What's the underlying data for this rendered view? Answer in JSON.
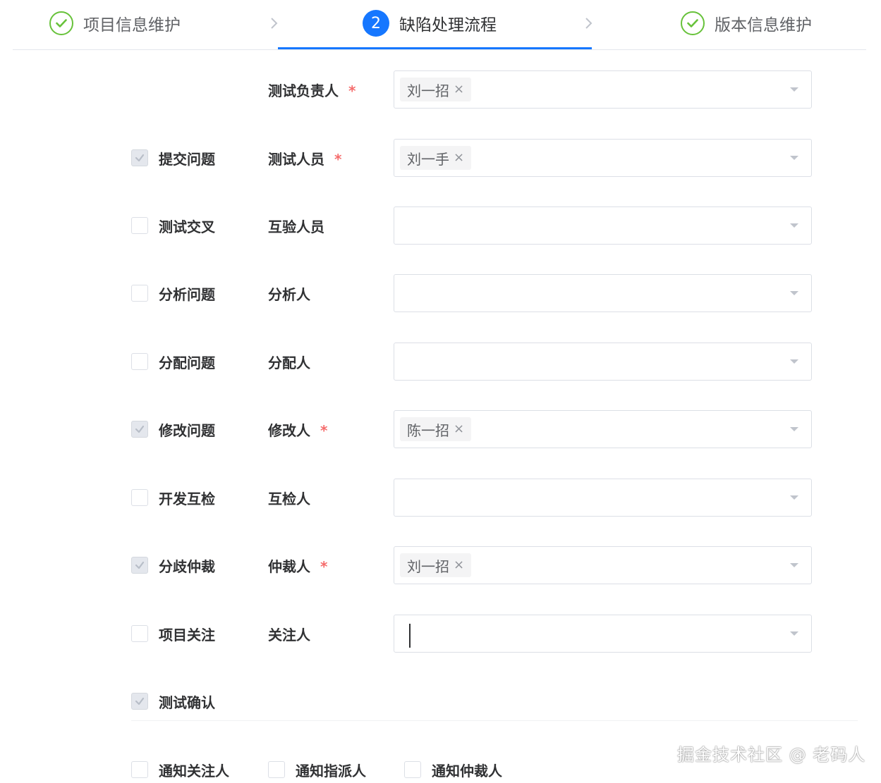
{
  "steps": [
    {
      "label": "项目信息维护",
      "status": "done"
    },
    {
      "label": "缺陷处理流程",
      "status": "active",
      "number": "2"
    },
    {
      "label": "版本信息维护",
      "status": "done"
    }
  ],
  "rows": [
    {
      "checkbox": null,
      "field_label": "测试负责人",
      "required": true,
      "tags": [
        "刘一招"
      ]
    },
    {
      "checkbox": {
        "label": "提交问题",
        "checked": true
      },
      "field_label": "测试人员",
      "required": true,
      "tags": [
        "刘一手"
      ]
    },
    {
      "checkbox": {
        "label": "测试交叉",
        "checked": false
      },
      "field_label": "互验人员",
      "required": false,
      "tags": []
    },
    {
      "checkbox": {
        "label": "分析问题",
        "checked": false
      },
      "field_label": "分析人",
      "required": false,
      "tags": []
    },
    {
      "checkbox": {
        "label": "分配问题",
        "checked": false
      },
      "field_label": "分配人",
      "required": false,
      "tags": []
    },
    {
      "checkbox": {
        "label": "修改问题",
        "checked": true
      },
      "field_label": "修改人",
      "required": true,
      "tags": [
        "陈一招"
      ]
    },
    {
      "checkbox": {
        "label": "开发互检",
        "checked": false
      },
      "field_label": "互检人",
      "required": false,
      "tags": []
    },
    {
      "checkbox": {
        "label": "分歧仲裁",
        "checked": true
      },
      "field_label": "仲裁人",
      "required": true,
      "tags": [
        "刘一招"
      ]
    },
    {
      "checkbox": {
        "label": "项目关注",
        "checked": false
      },
      "field_label": "关注人",
      "required": false,
      "tags": [],
      "focused": true
    },
    {
      "checkbox": {
        "label": "测试确认",
        "checked": true
      },
      "field_label": null
    }
  ],
  "required_mark": "*",
  "tag_close": "×",
  "notify": [
    {
      "label": "通知关注人",
      "checked": false
    },
    {
      "label": "通知指派人",
      "checked": false
    },
    {
      "label": "通知仲裁人",
      "checked": false
    }
  ],
  "watermark": "掘金技术社区 @ 老码人",
  "colors": {
    "primary": "#1677ff",
    "success": "#67c23a",
    "required": "#f56c6c",
    "border": "#dcdfe6"
  }
}
